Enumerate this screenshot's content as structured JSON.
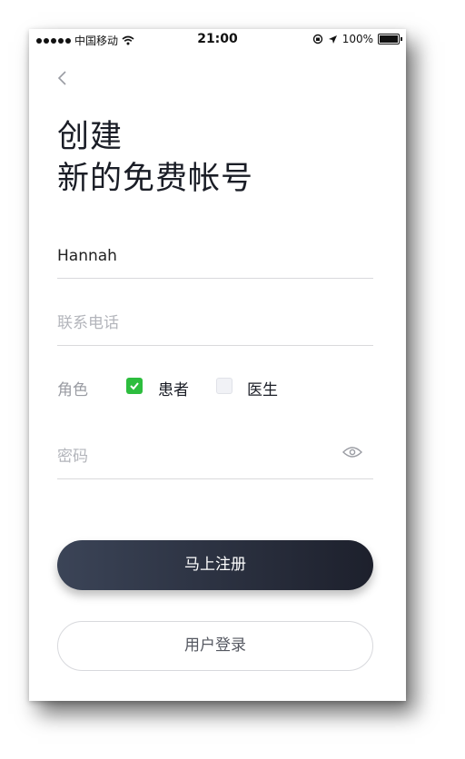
{
  "status_bar": {
    "carrier": "中国移动",
    "time": "21:00",
    "battery": "100%"
  },
  "header": {
    "title_line1": "创建",
    "title_line2": "新的免费帐号"
  },
  "form": {
    "name_value": "Hannah",
    "phone_placeholder": "联系电话",
    "role_label": "角色",
    "role_options": [
      {
        "label": "患者",
        "checked": true
      },
      {
        "label": "医生",
        "checked": false
      }
    ],
    "password_placeholder": "密码"
  },
  "actions": {
    "register_label": "马上注册",
    "login_label": "用户登录"
  },
  "colors": {
    "check_green": "#2dbd3e",
    "primary_dark": "#1d202c"
  }
}
